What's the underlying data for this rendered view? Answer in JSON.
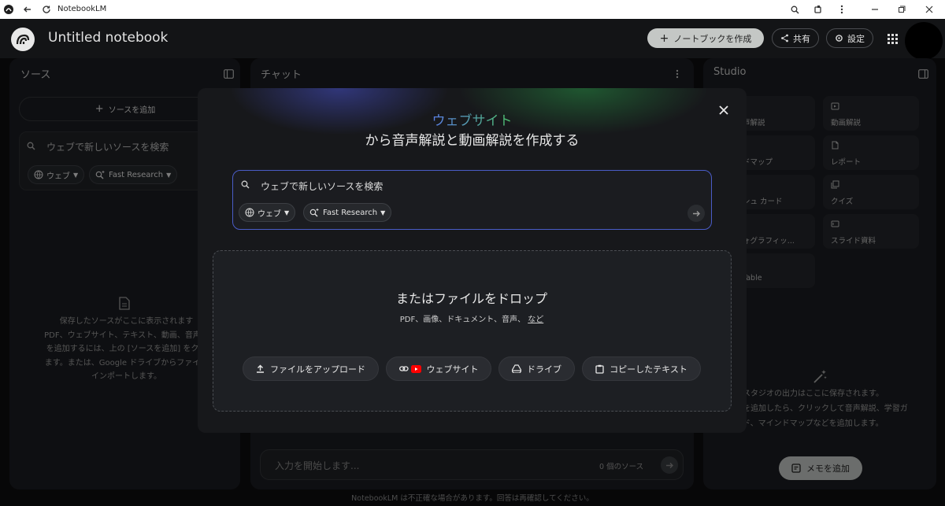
{
  "window": {
    "title": "NotebookLM"
  },
  "header": {
    "notebook_title": "Untitled notebook",
    "create_button": "ノートブックを作成",
    "share_button": "共有",
    "settings_button": "設定"
  },
  "sources_panel": {
    "title": "ソース",
    "add_button": "ソースを追加",
    "search_placeholder": "ウェブで新しいソースを検索",
    "web_chip": "ウェブ",
    "research_chip": "Fast Research",
    "empty_lines": [
      "保存したソースがここに表示されます",
      "PDF、ウェブサイト、テキスト、動画、音声フ",
      "を追加するには、上の [ソースを追加] をクリ",
      "ます。または、Google ドライブからファイル",
      "インポートします。"
    ]
  },
  "chat_panel": {
    "title": "チャット",
    "input_placeholder": "入力を開始します...",
    "source_count": "0 個のソース"
  },
  "studio_panel": {
    "title": "Studio",
    "items": [
      "音声解説",
      "動画解説",
      "マインドマップ",
      "レポート",
      "フラッシュ カード",
      "クイズ",
      "インフォグラフィッ...",
      "スライド資料",
      "Data Table"
    ],
    "visible_items": [
      "声解説",
      "動画解説",
      "ドマップ",
      "レポート",
      "シュ カード",
      "クイズ",
      "ォグラフィッ...",
      "スライド資料",
      "Table"
    ],
    "empty_lines": [
      "スタジオの出力はここに保存されます。",
      "を追加したら、クリックして音声解説、学習ガ",
      "ド、マインドマップなどを追加します。"
    ],
    "add_note_button": "メモを追加"
  },
  "modal": {
    "headline_highlight": "ウェブサイト",
    "headline_rest": "から音声解説と動画解説を作成する",
    "search_placeholder": "ウェブで新しいソースを検索",
    "web_chip": "ウェブ",
    "research_chip": "Fast Research",
    "drop_title": "またはファイルをドロップ",
    "drop_subtitle": "PDF、画像、ドキュメント、音声、",
    "drop_more_link": "など",
    "buttons": {
      "upload": "ファイルをアップロード",
      "website": "ウェブサイト",
      "drive": "ドライブ",
      "paste": "コピーしたテキスト"
    }
  },
  "footer": {
    "disclaimer": "NotebookLM は不正確な場合があります。回答は再確認してください。"
  },
  "colors": {
    "accent_blue": "#5b7fe8",
    "accent_green": "#4ec36a",
    "youtube_red": "#ff0000",
    "pill_light": "#c4c7c5"
  }
}
